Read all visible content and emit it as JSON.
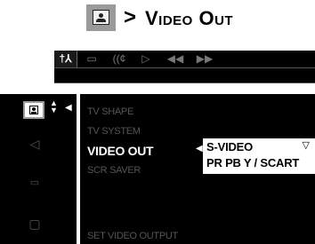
{
  "heading": {
    "icon": "picture-setup-icon",
    "separator": ">",
    "title": "Video Out"
  },
  "menubar": {
    "tabs": [
      {
        "icon": "settings-icon",
        "glyph": "†⅄",
        "active": true
      },
      {
        "icon": "subtitle-icon",
        "glyph": "▭",
        "active": false
      },
      {
        "icon": "audio-icon",
        "glyph": "((¢",
        "active": false
      },
      {
        "icon": "play-icon",
        "glyph": "▷",
        "active": false
      },
      {
        "icon": "rewind-icon",
        "glyph": "◀◀",
        "active": false
      },
      {
        "icon": "forward-icon",
        "glyph": "▶▶",
        "active": false
      }
    ]
  },
  "sidebar": {
    "items": [
      {
        "icon": "picture-icon",
        "selected": true
      },
      {
        "icon": "speaker-icon",
        "glyph": "◁",
        "selected": false
      },
      {
        "icon": "chat-icon",
        "glyph": "💬",
        "selected": false
      },
      {
        "icon": "briefcase-icon",
        "glyph": "⎘",
        "selected": false
      }
    ]
  },
  "menu": {
    "items": [
      {
        "label": "TV SHAPE"
      },
      {
        "label": "TV SYSTEM"
      },
      {
        "label": "VIDEO OUT"
      },
      {
        "label": "SCR SAVER"
      }
    ],
    "footer": "SET VIDEO OUTPUT"
  },
  "options": {
    "selected": "S-VIDEO",
    "alternate": "PR PB Y / SCART",
    "dropdown_icon": "▽"
  },
  "colors": {
    "panel": "#000000",
    "dim_text": "#555555",
    "active_text": "#ffffff"
  }
}
